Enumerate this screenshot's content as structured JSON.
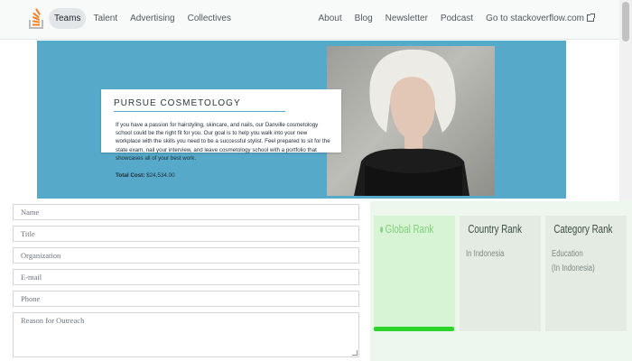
{
  "topnav": {
    "left_items": [
      {
        "label": "Teams",
        "active": true
      },
      {
        "label": "Talent",
        "active": false
      },
      {
        "label": "Advertising",
        "active": false
      },
      {
        "label": "Collectives",
        "active": false
      }
    ],
    "right_items": [
      {
        "label": "About"
      },
      {
        "label": "Blog"
      },
      {
        "label": "Newsletter"
      },
      {
        "label": "Podcast"
      },
      {
        "label": "Go to stackoverflow.com"
      }
    ],
    "logo_icon": "stack-overflow-logo-icon",
    "external_icon": "external-link-icon",
    "brand_color": "#f48024"
  },
  "hero": {
    "title": "PURSUE COSMETOLOGY",
    "description": "If you have a passion for hairstyling, skincare, and nails, our Danville cosmetology school could be the right fit for you. Our goal is to help you walk into your new workplace with the skills you need to be a successful stylist. Feel prepared to sit for the state exam, nail your interview, and leave cosmetology school with a portfolio that showcases all of your best work.",
    "cost_label": "Total Cost:",
    "cost_value": "$24,534.00",
    "background_color": "#57a9c9"
  },
  "form": {
    "fields": [
      {
        "placeholder": "Name"
      },
      {
        "placeholder": "Title"
      },
      {
        "placeholder": "Organization"
      },
      {
        "placeholder": "E-mail"
      },
      {
        "placeholder": "Phone"
      }
    ],
    "textarea_placeholder": "Reason for Outreach"
  },
  "ranks": [
    {
      "title": "Global Rank",
      "subtitle": "",
      "subtitle2": ""
    },
    {
      "title": "Country Rank",
      "subtitle": "In Indonesia",
      "subtitle2": ""
    },
    {
      "title": "Category Rank",
      "subtitle": "Education",
      "subtitle2": "(In Indonesia)"
    }
  ],
  "rank_accent_color": "#2bd62b"
}
